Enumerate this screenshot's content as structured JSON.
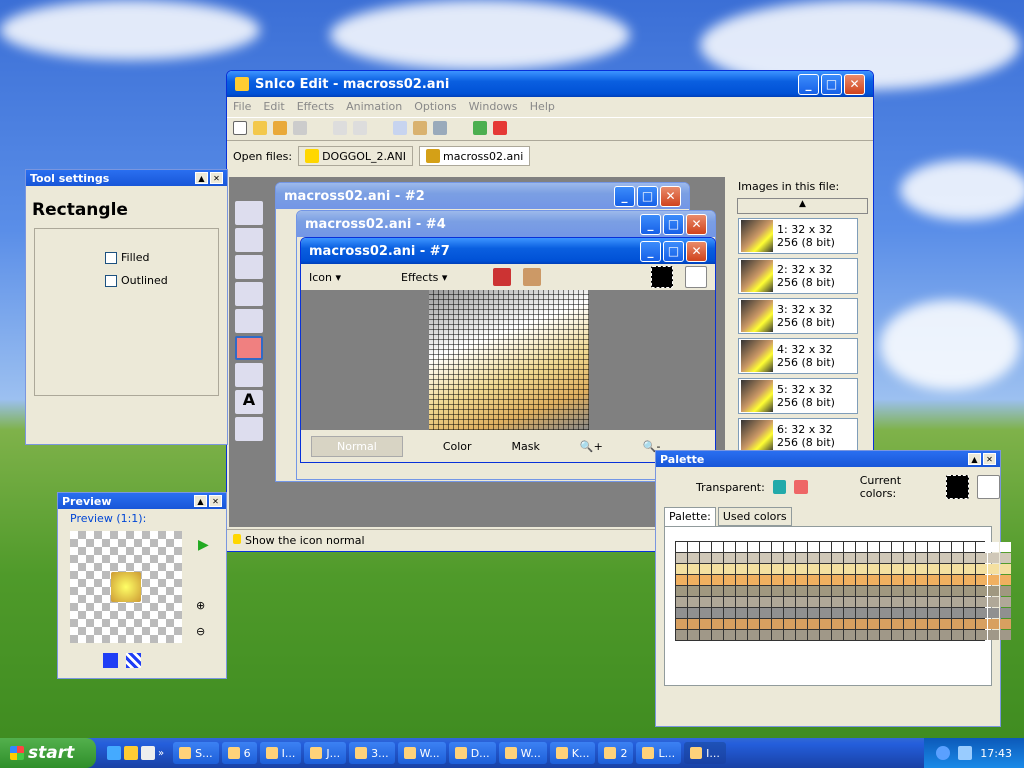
{
  "main_window": {
    "title": "SnIco Edit - macross02.ani",
    "menu": [
      "File",
      "Edit",
      "Effects",
      "Animation",
      "Options",
      "Windows",
      "Help"
    ],
    "open_files_label": "Open files:",
    "open_files": [
      "DOGGOL_2.ANI",
      "macross02.ani"
    ],
    "status": "Show the icon normal"
  },
  "children": {
    "w1": "macross02.ani - #2",
    "w2": "macross02.ani - #4",
    "w3": "macross02.ani - #7",
    "dd_icon": "Icon",
    "dd_effects": "Effects",
    "tab_normal": "Normal",
    "tab_color": "Color",
    "tab_mask": "Mask"
  },
  "images_panel": {
    "title": "Images in this file:",
    "items": [
      {
        "n": "1: 32 x 32",
        "d": "256 (8 bit)"
      },
      {
        "n": "2: 32 x 32",
        "d": "256 (8 bit)"
      },
      {
        "n": "3: 32 x 32",
        "d": "256 (8 bit)"
      },
      {
        "n": "4: 32 x 32",
        "d": "256 (8 bit)"
      },
      {
        "n": "5: 32 x 32",
        "d": "256 (8 bit)"
      },
      {
        "n": "6: 32 x 32",
        "d": "256 (8 bit)"
      }
    ]
  },
  "tool_settings": {
    "title": "Tool settings",
    "tool": "Rectangle",
    "filled": "Filled",
    "outlined": "Outlined"
  },
  "preview": {
    "title": "Preview",
    "label": "Preview (1:1):"
  },
  "palette": {
    "title": "Palette",
    "transparent": "Transparent:",
    "current": "Current colors:",
    "tab1": "Palette:",
    "tab2": "Used colors"
  },
  "taskbar": {
    "start": "start",
    "time": "17:43",
    "buttons": [
      "S...",
      "6",
      "I...",
      "J...",
      "3...",
      "W...",
      "D...",
      "W...",
      "K...",
      "2",
      "L...",
      "I..."
    ]
  },
  "colors": {
    "xp_blue": "#0a5fe0",
    "palette_rows": [
      "#ffffff",
      "#d0c8b8",
      "#f4e0a0",
      "#f0b060",
      "#a09880",
      "#b0a898",
      "#909090",
      "#d8a060",
      "#a09888"
    ]
  }
}
